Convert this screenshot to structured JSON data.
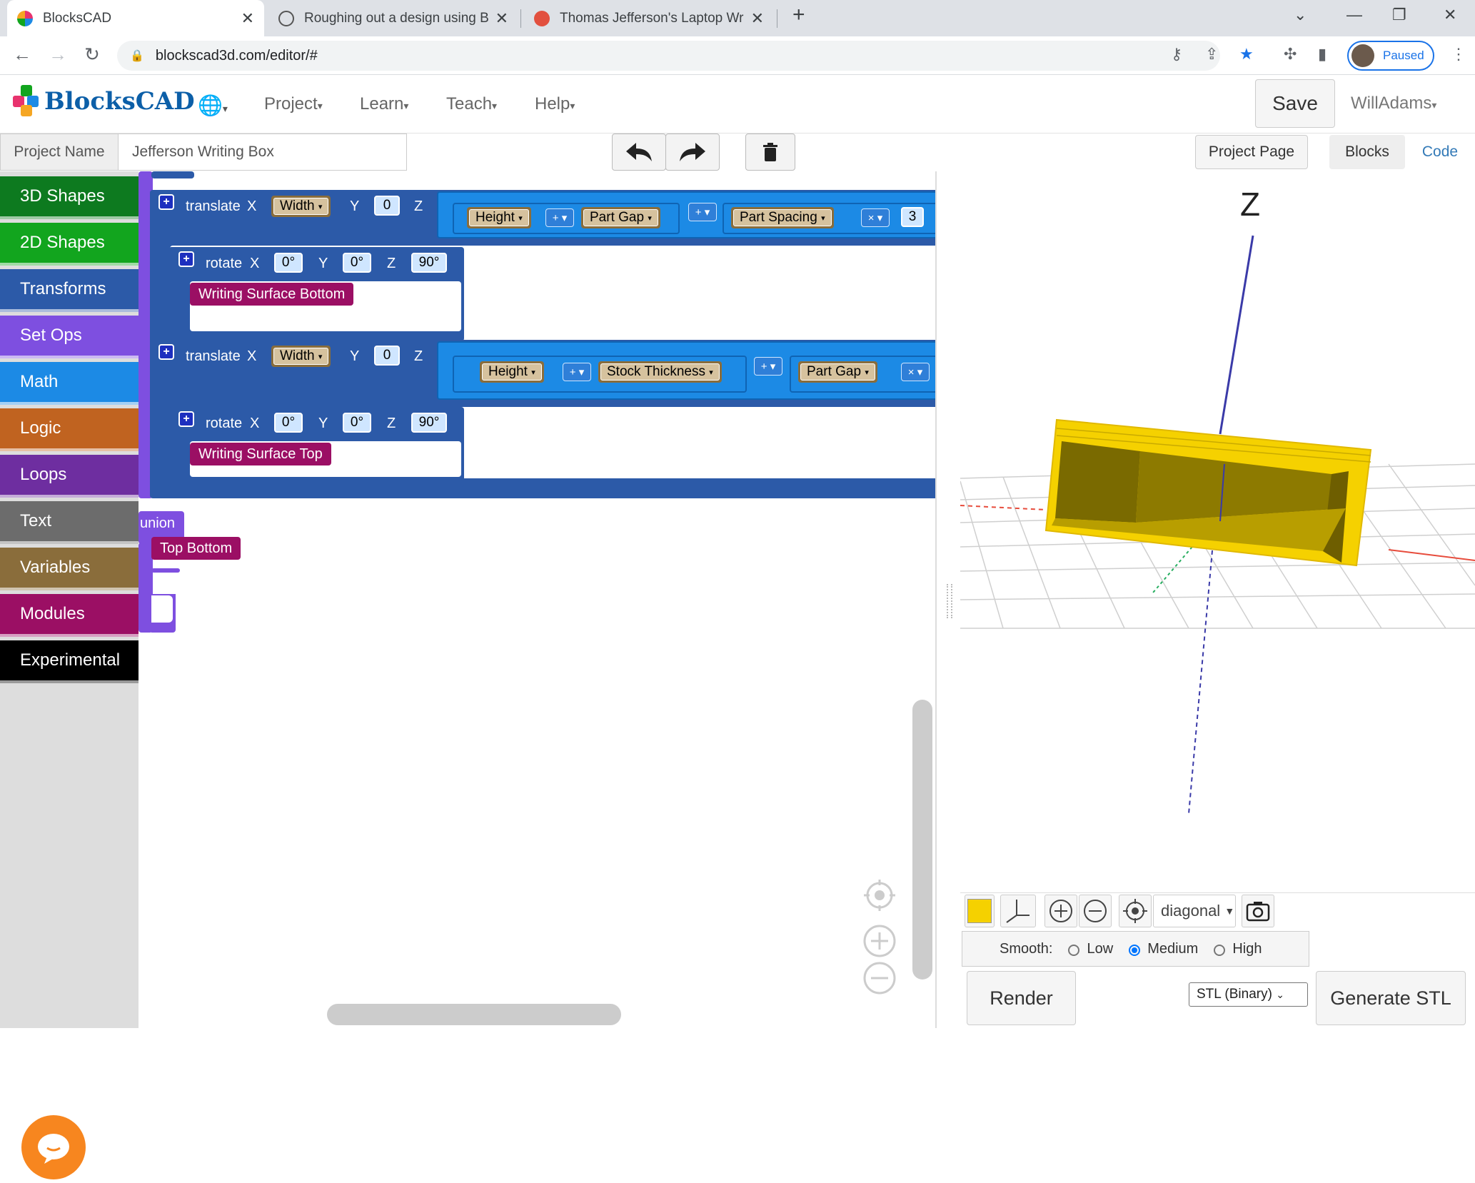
{
  "browser": {
    "tabs": [
      {
        "label": "BlocksCAD",
        "active": true
      },
      {
        "label": "Roughing out a design using Blo",
        "active": false
      },
      {
        "label": "Thomas Jefferson's Laptop Writin",
        "active": false
      }
    ],
    "url": "blockscad3d.com/editor/#",
    "profile_label": "Paused"
  },
  "app": {
    "logo_text": "BlocksCAD",
    "menus": [
      "Project",
      "Learn",
      "Teach",
      "Help"
    ],
    "save_label": "Save",
    "user_label": "WillAdams"
  },
  "project": {
    "name_label": "Project Name",
    "name_value": "Jefferson Writing Box",
    "project_page_label": "Project Page",
    "tab_blocks": "Blocks",
    "tab_code": "Code"
  },
  "categories": [
    {
      "label": "3D Shapes",
      "color": "#0d7a1f"
    },
    {
      "label": "2D Shapes",
      "color": "#12a51e"
    },
    {
      "label": "Transforms",
      "color": "#2c5aa8"
    },
    {
      "label": "Set Ops",
      "color": "#7e4fe0"
    },
    {
      "label": "Math",
      "color": "#1c8ae5"
    },
    {
      "label": "Logic",
      "color": "#c06320"
    },
    {
      "label": "Loops",
      "color": "#6e2ea0"
    },
    {
      "label": "Text",
      "color": "#6c6c6c"
    },
    {
      "label": "Variables",
      "color": "#8a6d3b"
    },
    {
      "label": "Modules",
      "color": "#9b0f64"
    },
    {
      "label": "Experimental",
      "color": "#000000"
    }
  ],
  "blocks": {
    "translate1": {
      "label": "translate",
      "x": "X",
      "x_var": "Width",
      "y": "Y",
      "y_val": "0",
      "z": "Z",
      "terms": [
        "Height",
        "Part Gap",
        "Part Spacing"
      ],
      "ops": [
        "+",
        "+",
        "×"
      ],
      "num": "3"
    },
    "rotate1": {
      "label": "rotate",
      "x": "X",
      "x_val": "0°",
      "y": "Y",
      "y_val": "0°",
      "z": "Z",
      "z_val": "90°"
    },
    "module1": "Writing Surface Bottom",
    "translate2": {
      "label": "translate",
      "x": "X",
      "x_var": "Width",
      "y": "Y",
      "y_val": "0",
      "z": "Z",
      "terms": [
        "Height",
        "Stock Thickness",
        "Part Gap"
      ],
      "ops": [
        "+",
        "+",
        "×"
      ]
    },
    "rotate2": {
      "label": "rotate",
      "x": "X",
      "x_val": "0°",
      "y": "Y",
      "y_val": "0°",
      "z": "Z",
      "z_val": "90°"
    },
    "module2": "Writing Surface Top",
    "union_label": "union",
    "module3": "Top Bottom"
  },
  "viewer": {
    "axis_label": "Z",
    "view_select": "diagonal",
    "smooth_label": "Smooth:",
    "smooth_options": [
      "Low",
      "Medium",
      "High"
    ],
    "smooth_selected": "Medium",
    "render_label": "Render",
    "export_format": "STL (Binary)",
    "generate_label": "Generate STL",
    "object_color": "#f5d100"
  }
}
